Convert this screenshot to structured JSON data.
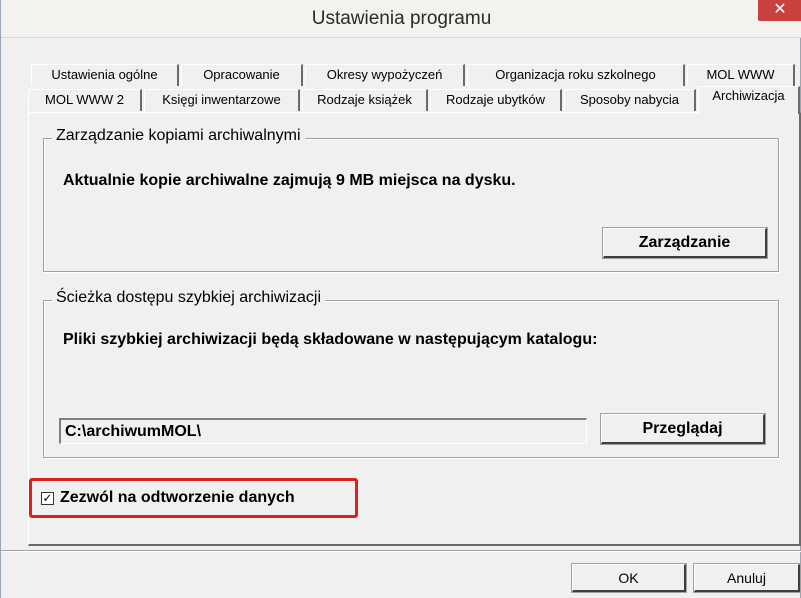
{
  "window": {
    "title": "Ustawienia programu",
    "close_glyph": "✕"
  },
  "tabs_row1": [
    {
      "label": "Ustawienia ogólne"
    },
    {
      "label": "Opracowanie"
    },
    {
      "label": "Okresy wypożyczeń"
    },
    {
      "label": "Organizacja roku szkolnego"
    },
    {
      "label": "MOL WWW"
    }
  ],
  "tabs_row2": [
    {
      "label": "MOL WWW 2"
    },
    {
      "label": "Księgi inwentarzowe"
    },
    {
      "label": "Rodzaje książek"
    },
    {
      "label": "Rodzaje ubytków"
    },
    {
      "label": "Sposoby nabycia"
    },
    {
      "label": "Archiwizacja",
      "active": true
    }
  ],
  "archive_copies": {
    "title": "Zarządzanie kopiami archiwalnymi",
    "info": "Aktualnie kopie archiwalne zajmują 9 MB miejsca na dysku.",
    "manage_button": "Zarządzanie"
  },
  "quick_archive": {
    "title": "Ścieżka dostępu szybkiej archiwizacji",
    "info": "Pliki szybkiej archiwizacji będą składowane w następującym katalogu:",
    "path_value": "C:\\archiwumMOL\\",
    "browse_button": "Przeglądaj"
  },
  "restore": {
    "label": "Zezwól na odtworzenie danych",
    "checked": true,
    "check_glyph": "✓"
  },
  "footer": {
    "ok": "OK",
    "cancel": "Anuluj"
  },
  "colors": {
    "close_red": "#c8413f",
    "highlight_red": "#e02020",
    "dialog_bg": "#f0f0f0"
  }
}
